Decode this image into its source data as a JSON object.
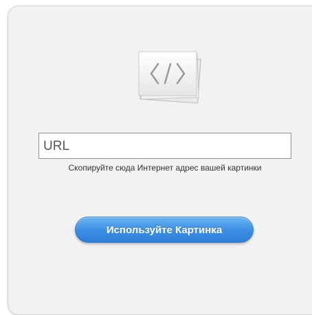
{
  "icons": {
    "embed": "code-brackets-icon"
  },
  "url_field": {
    "placeholder": "URL",
    "value": ""
  },
  "hint": {
    "text": "Скопируйте сюда Интернет адрес вашей картинки"
  },
  "action": {
    "label": "Используйте Картинка"
  },
  "colors": {
    "panel_background": "#f2f2f2",
    "button_accent": "#3d91e4",
    "button_text": "#ffffff"
  }
}
